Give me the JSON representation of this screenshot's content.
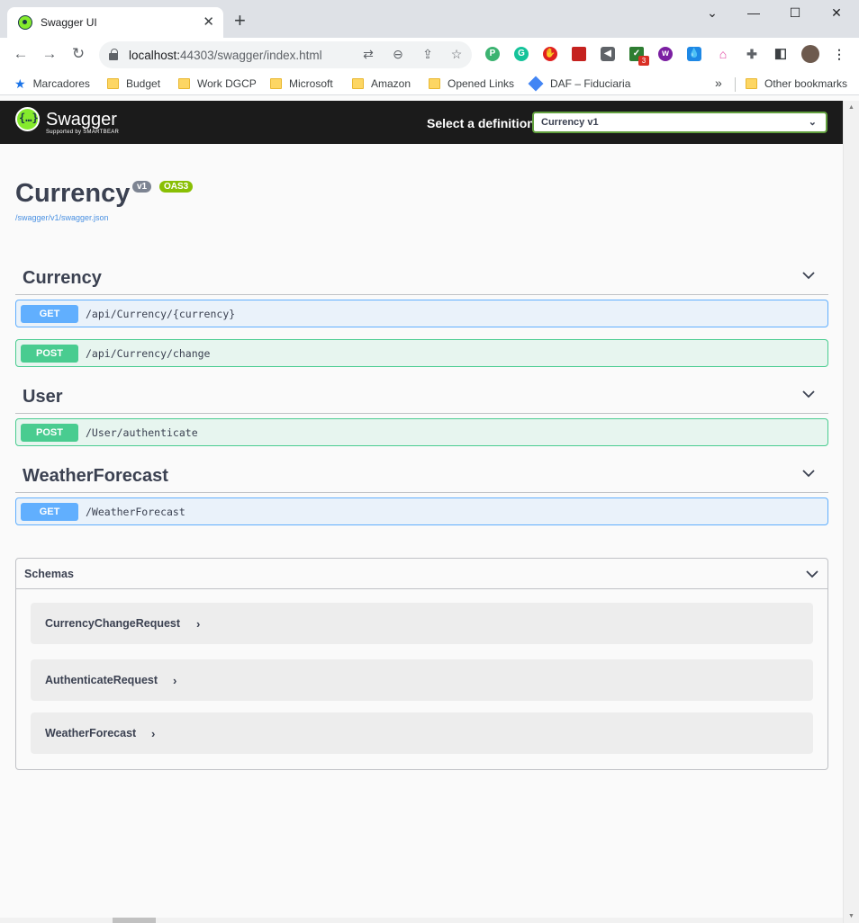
{
  "browser": {
    "tab_title": "Swagger UI",
    "url_host": "localhost:",
    "url_rest": "44303/swagger/index.html",
    "bookmarks": [
      "Marcadores",
      "Budget",
      "Work DGCP",
      "Microsoft",
      "Amazon",
      "Opened Links",
      "DAF – Fiduciaria"
    ],
    "other_bookmarks": "Other bookmarks",
    "extension_badge": "3"
  },
  "topbar": {
    "logo": "Swagger",
    "logo_sub": "Supported by SMARTBEAR",
    "definition_label": "Select a definition",
    "definition_value": "Currency v1"
  },
  "info": {
    "title": "Currency",
    "version": "v1",
    "oas": "OAS3",
    "spec_link": "/swagger/v1/swagger.json"
  },
  "tags": [
    {
      "name": "Currency",
      "operations": [
        {
          "method": "GET",
          "path": "/api/Currency/{currency}"
        },
        {
          "method": "POST",
          "path": "/api/Currency/change"
        }
      ]
    },
    {
      "name": "User",
      "operations": [
        {
          "method": "POST",
          "path": "/User/authenticate"
        }
      ]
    },
    {
      "name": "WeatherForecast",
      "operations": [
        {
          "method": "GET",
          "path": "/WeatherForecast"
        }
      ]
    }
  ],
  "schemas": {
    "title": "Schemas",
    "items": [
      "CurrencyChangeRequest",
      "AuthenticateRequest",
      "WeatherForecast"
    ]
  },
  "colors": {
    "get": "#61affe",
    "post": "#49cc90",
    "topbar": "#1b1b1b",
    "swagger_green": "#85ea2d"
  }
}
